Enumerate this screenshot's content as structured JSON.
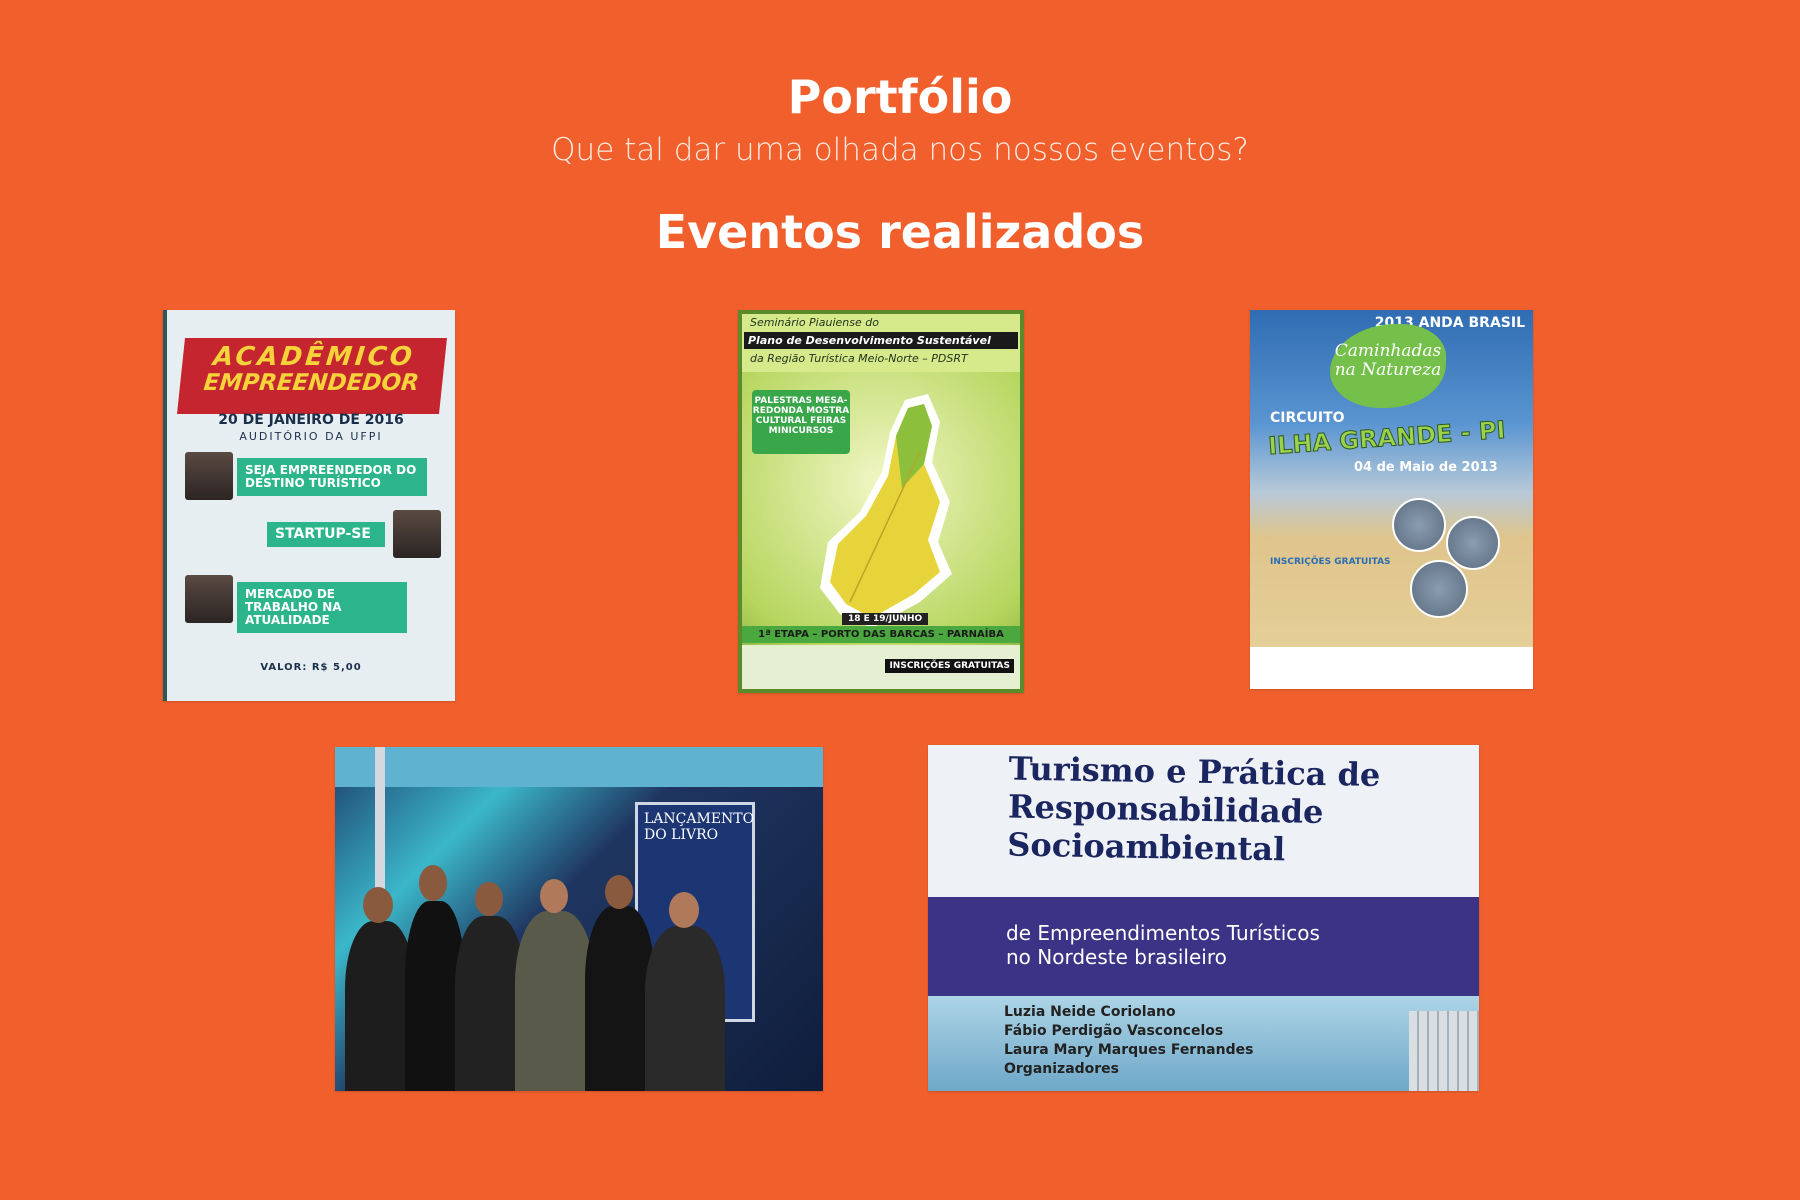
{
  "header": {
    "title": "Portfólio",
    "subtitle": "Que tal dar uma olhada nos nossos eventos?",
    "section_title": "Eventos realizados"
  },
  "events": {
    "poster1": {
      "banner_line1": "ACADÊMICO",
      "banner_line2": "EMPREENDEDOR",
      "date": "20 DE JANEIRO DE 2016",
      "venue": "AUDITÓRIO DA UFPI",
      "talk1": "SEJA EMPREENDEDOR DO DESTINO TURÍSTICO",
      "talk2": "STARTUP-SE",
      "talk3": "MERCADO DE TRABALHO NA ATUALIDADE",
      "price": "VALOR: R$ 5,00"
    },
    "poster2": {
      "line1": "Seminário Piauiense do",
      "line2": "Plano de Desenvolvimento Sustentável",
      "line3": "da Região Turística Meio-Norte – PDSRT",
      "activities": "PALESTRAS MESA-REDONDA MOSTRA CULTURAL FEIRAS MINICURSOS",
      "dates": "18 E 19/JUNHO",
      "stage": "1ª ETAPA – PORTO DAS BARCAS – PARNAÍBA",
      "registration": "INSCRIÇÕES GRATUITAS"
    },
    "poster3": {
      "year_org": "2013 ANDA BRASIL",
      "badge": "Caminhadas na Natureza",
      "circuit": "CIRCUITO",
      "place": "ILHA GRANDE - PI",
      "date": "04 de Maio de 2013",
      "registration": "INSCRIÇÕES GRATUITAS"
    },
    "photo": {
      "panel_text": "LANÇAMENTO DO LIVRO"
    },
    "book": {
      "title": "Turismo e Prática de Responsabilidade Socioambiental",
      "subtitle_line1": "de Empreendimentos Turísticos",
      "subtitle_line2": "no Nordeste brasileiro",
      "author1": "Luzia Neide Coriolano",
      "author2": "Fábio Perdigão Vasconcelos",
      "author3": "Laura Mary Marques Fernandes",
      "role": "Organizadores"
    }
  }
}
